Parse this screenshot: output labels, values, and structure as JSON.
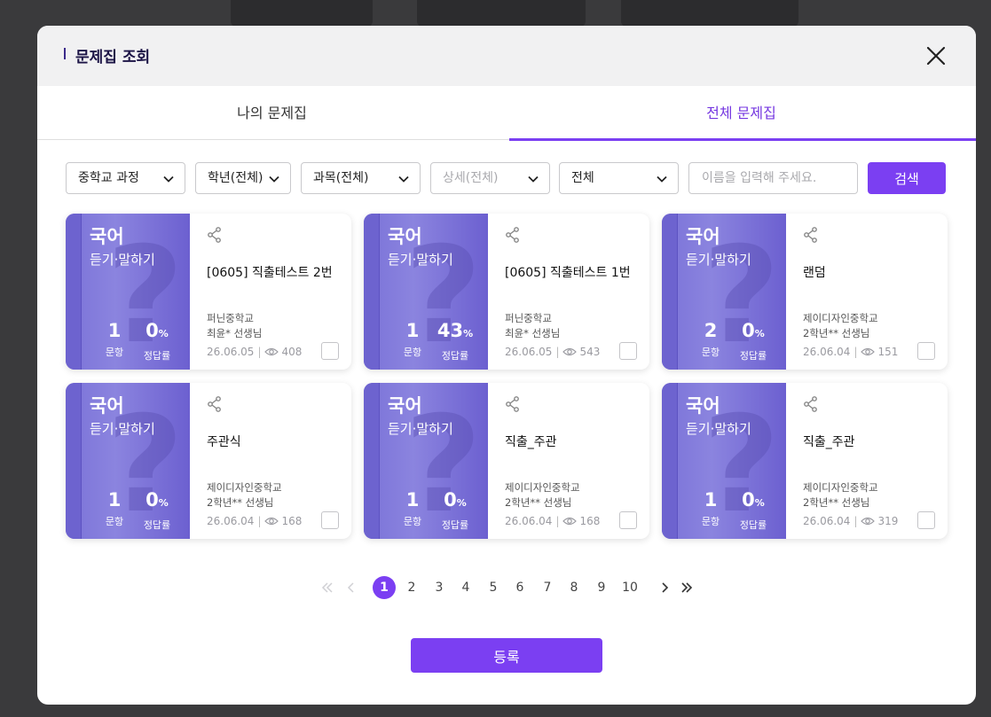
{
  "modal": {
    "title": "문제집 조회"
  },
  "tabs": [
    {
      "label": "나의 문제집",
      "active": false
    },
    {
      "label": "전체 문제집",
      "active": true
    }
  ],
  "filters": {
    "course": "중학교 과정",
    "grade": "학년(전체)",
    "subject": "과목(전체)",
    "detail": "상세(전체)",
    "scope": "전체",
    "search_placeholder": "이름을 입력해 주세요.",
    "search_label": "검색"
  },
  "cards": [
    {
      "subject": "국어",
      "sub": "듣기·말하기",
      "count": "1",
      "rate": "0",
      "pct": "%",
      "count_label": "문항",
      "rate_label": "정답률",
      "title": "[0605] 직출테스트 2번",
      "school": "퍼닌중학교",
      "teacher": "최윤* 선생님",
      "date": "26.06.05",
      "views": "408"
    },
    {
      "subject": "국어",
      "sub": "듣기·말하기",
      "count": "1",
      "rate": "43",
      "pct": "%",
      "count_label": "문항",
      "rate_label": "정답률",
      "title": "[0605] 직출테스트 1번",
      "school": "퍼닌중학교",
      "teacher": "최윤* 선생님",
      "date": "26.06.05",
      "views": "543"
    },
    {
      "subject": "국어",
      "sub": "듣기·말하기",
      "count": "2",
      "rate": "0",
      "pct": "%",
      "count_label": "문항",
      "rate_label": "정답률",
      "title": "랜덤",
      "school": "제이디자인중학교",
      "teacher": "2학년** 선생님",
      "date": "26.06.04",
      "views": "151"
    },
    {
      "subject": "국어",
      "sub": "듣기·말하기",
      "count": "1",
      "rate": "0",
      "pct": "%",
      "count_label": "문항",
      "rate_label": "정답률",
      "title": "주관식",
      "school": "제이디자인중학교",
      "teacher": "2학년** 선생님",
      "date": "26.06.04",
      "views": "168"
    },
    {
      "subject": "국어",
      "sub": "듣기·말하기",
      "count": "1",
      "rate": "0",
      "pct": "%",
      "count_label": "문항",
      "rate_label": "정답률",
      "title": "직출_주관",
      "school": "제이디자인중학교",
      "teacher": "2학년** 선생님",
      "date": "26.06.04",
      "views": "168"
    },
    {
      "subject": "국어",
      "sub": "듣기·말하기",
      "count": "1",
      "rate": "0",
      "pct": "%",
      "count_label": "문항",
      "rate_label": "정답률",
      "title": "직출_주관",
      "school": "제이디자인중학교",
      "teacher": "2학년** 선생님",
      "date": "26.06.04",
      "views": "319"
    }
  ],
  "pagination": {
    "pages": [
      "1",
      "2",
      "3",
      "4",
      "5",
      "6",
      "7",
      "8",
      "9",
      "10"
    ],
    "current": "1"
  },
  "register_label": "등록",
  "colors": {
    "accent": "#7b3ff2",
    "cover": "#7a72d8"
  }
}
